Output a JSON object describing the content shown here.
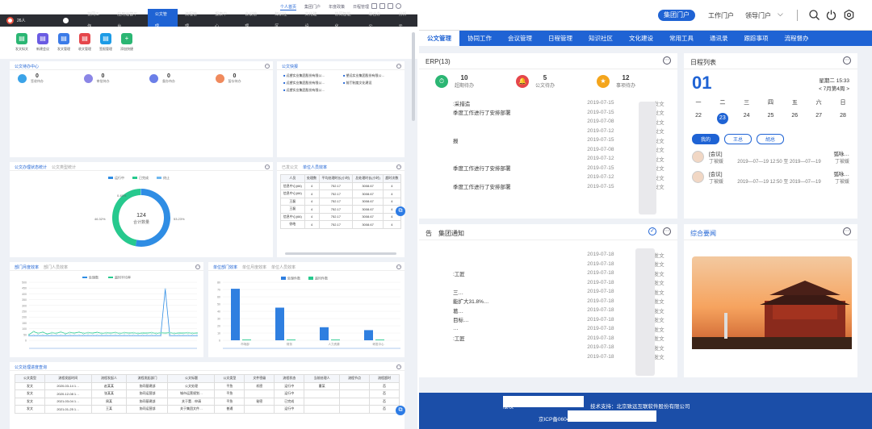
{
  "left": {
    "toplinks": [
      {
        "label": "个人首页",
        "active": true
      },
      {
        "label": "集团门户",
        "active": false
      },
      {
        "label": "年度政策",
        "active": false
      },
      {
        "label": "日程管理",
        "active": false
      }
    ],
    "user": "26人",
    "nav": [
      {
        "label": "协同工作"
      },
      {
        "label": "应用运营平台"
      },
      {
        "label": "公文管理",
        "active": true
      },
      {
        "label": "流程管理"
      },
      {
        "label": "报表中心"
      },
      {
        "label": "会议管理"
      },
      {
        "label": "知识社区"
      },
      {
        "label": "文化建设"
      },
      {
        "label": "协同智能化"
      },
      {
        "label": "综合办公"
      },
      {
        "label": "分析云"
      }
    ],
    "quick": [
      {
        "label": "发文拟文",
        "color": "#2bb673",
        "icon": "doc-icon"
      },
      {
        "label": "新建会议",
        "color": "#6a5be3",
        "icon": "meeting-icon"
      },
      {
        "label": "发文管理",
        "color": "#3b7be8",
        "icon": "send-icon"
      },
      {
        "label": "收文管理",
        "color": "#e5464b",
        "icon": "receive-icon"
      },
      {
        "label": "签报管理",
        "color": "#1c9be6",
        "icon": "report-icon"
      },
      {
        "label": "添加快捷",
        "color": "#2bb673",
        "icon": "plus-icon"
      }
    ],
    "todo": {
      "title": "公文待办中心",
      "items": [
        {
          "n": "0",
          "l": "签收待办",
          "color": "#3ba3e8"
        },
        {
          "label": "",
          "n": "0",
          "l": "审批待办",
          "color": "#8b86e6"
        },
        {
          "n": "0",
          "l": "督办待办",
          "color": "#6b7fe8"
        },
        {
          "n": "0",
          "l": "暂存待办",
          "color": "#f08a5d"
        }
      ]
    },
    "notice": {
      "title": "公文快报",
      "items": [
        "远望实业集团股份有限公…",
        "望远实业集团股份有限公…",
        "远望实业集团股份有限公…",
        "前厅制度文化建设",
        "远望实业集团股份有限公…"
      ]
    },
    "donut": {
      "title": "公文办理状态统计",
      "tab": "公文类型统计",
      "legend": [
        "运行中",
        "已完成",
        "终止"
      ],
      "center_value": "124",
      "center_label": "合计数量",
      "pct_left": "46.32%",
      "pct_right": "53.23%",
      "pct_top": "0.45%"
    },
    "unit": {
      "title": "已发公文",
      "tab": "单位人员效率",
      "cols": [
        "人员",
        "处理数",
        "平均处理时长(小时)",
        "总处理时长(小时)",
        "超时次数"
      ],
      "rows": [
        [
          "信息中心(66)",
          "4",
          "752.17",
          "3008.67",
          "4"
        ],
        [
          "信息中心(66)",
          "4",
          "752.17",
          "3008.67",
          "4"
        ],
        [
          "王磊",
          "4",
          "752.17",
          "3008.67",
          "4"
        ],
        [
          "王磊",
          "4",
          "752.17",
          "3008.67",
          "4"
        ],
        [
          "信息中心(66)",
          "4",
          "752.17",
          "3008.67",
          "4"
        ],
        [
          "徐皓",
          "4",
          "752.17",
          "3008.67",
          "4"
        ]
      ]
    },
    "line": {
      "title": "部门月度效率",
      "tab": "部门人员效率",
      "legend": [
        "处理数",
        "超时平均率"
      ]
    },
    "bar": {
      "title": "单位部门效率",
      "tab": "单位月度效率",
      "tab2": "单位人员效率",
      "legend": [
        "处理件数",
        "超时件数"
      ]
    },
    "query": {
      "title": "公文处理进度查询",
      "cols": [
        "公文类型",
        "流程发起时间",
        "流程发起人",
        "流程发起部门",
        "公文标题",
        "公文类型",
        "文件密级",
        "流程状态",
        "当前处理人",
        "流程节点",
        "流程超时"
      ],
      "rows": [
        [
          "发文",
          "2020-03-14 1…",
          "赵某某",
          "协同基建部",
          "公文处理",
          "平急",
          "机密",
          "运行中",
          "曹某",
          "",
          "否"
        ],
        [
          "发文",
          "2020-12-08 1…",
          "张某某",
          "协同运营部",
          "城市运营规划…",
          "平急",
          "",
          "运行中",
          "",
          "",
          "否"
        ],
        [
          "发文",
          "2021-03-04 1…",
          "周某",
          "协同基建部",
          "关于董…申请",
          "平急",
          "秘密",
          "已完成",
          "",
          "",
          "否"
        ],
        [
          "发文",
          "2021-01-25 1…",
          "王某",
          "协同运营部",
          "关于集团文件…",
          "普通",
          "",
          "运行中",
          "",
          "",
          "否"
        ]
      ]
    }
  },
  "chart_data": [
    {
      "type": "pie",
      "series": [
        {
          "name": "运行中",
          "value": 53.23
        },
        {
          "name": "已完成",
          "value": 46.32
        },
        {
          "name": "终止",
          "value": 0.45
        }
      ],
      "center_value": 124,
      "center_label": "合计数量"
    },
    {
      "type": "line",
      "series": [
        {
          "name": "处理数",
          "values": [
            40,
            40,
            40,
            40,
            40,
            40,
            40,
            40,
            40,
            40,
            40,
            40,
            40,
            40,
            40,
            40,
            40,
            40,
            40,
            40,
            40,
            40,
            40,
            40,
            40,
            40,
            40,
            40,
            40,
            40,
            440,
            40,
            40,
            40,
            40,
            40,
            40,
            40
          ]
        },
        {
          "name": "超时平均率",
          "values": [
            50,
            75,
            60,
            70,
            55,
            65,
            60,
            72,
            58,
            66,
            62,
            70,
            60,
            65,
            62,
            68,
            60,
            64,
            62,
            66,
            60,
            65,
            62,
            64,
            60,
            63,
            62,
            65,
            60,
            64,
            62,
            65,
            60,
            63,
            62,
            64,
            61,
            63
          ]
        }
      ],
      "ylim": [
        0,
        500
      ],
      "yticks": [
        0,
        50,
        100,
        150,
        200,
        250,
        300,
        350,
        400,
        450,
        500
      ]
    },
    {
      "type": "bar",
      "categories": [
        "市场部",
        "财务",
        "人力资源",
        "研发中心"
      ],
      "series": [
        {
          "name": "处理件数",
          "values": [
            71,
            45,
            18,
            14
          ]
        },
        {
          "name": "超时件数",
          "values": [
            1,
            1,
            1,
            1
          ]
        }
      ],
      "ylim": [
        0,
        80
      ],
      "yticks": [
        0,
        10,
        20,
        30,
        40,
        50,
        60,
        70,
        80
      ]
    }
  ],
  "right": {
    "header": {
      "portal": "集团门户",
      "work": "工作门户",
      "leader": "领导门户"
    },
    "nav": [
      {
        "label": "公文管理",
        "active": true
      },
      {
        "label": "协同工作"
      },
      {
        "label": "会议管理"
      },
      {
        "label": "日程管理"
      },
      {
        "label": "知识社区"
      },
      {
        "label": "文化建设"
      },
      {
        "label": "常用工具"
      },
      {
        "label": "通讯录"
      },
      {
        "label": "跟踪事项"
      },
      {
        "label": "流程督办"
      }
    ],
    "erp": {
      "title": "ERP(13)",
      "stats": [
        {
          "n": "10",
          "l": "超期待办",
          "color": "#2bb673"
        },
        {
          "n": "5",
          "l": "公文待办",
          "color": "#e5464b"
        },
        {
          "n": "12",
          "l": "事项待办",
          "color": "#f4a51c"
        }
      ],
      "rows": [
        {
          "t": ":采措造",
          "d": "2019-07-15",
          "ty": "发文"
        },
        {
          "t": "季度工作进行了安排部署",
          "d": "2019-07-15",
          "ty": "发文"
        },
        {
          "t": "",
          "d": "2019-07-08",
          "ty": "发文"
        },
        {
          "t": "",
          "d": "2019-07-12",
          "ty": "发文"
        },
        {
          "t": "报",
          "d": "2019-07-15",
          "ty": "发文"
        },
        {
          "t": "",
          "d": "2019-07-08",
          "ty": "发文"
        },
        {
          "t": "",
          "d": "2019-07-12",
          "ty": "发文"
        },
        {
          "t": "季度工作进行了安排部署",
          "d": "2019-07-15",
          "ty": "发文"
        },
        {
          "t": "",
          "d": "2019-07-12",
          "ty": "发文"
        },
        {
          "t": "季度工作进行了安排部署",
          "d": "2019-07-15",
          "ty": "发文"
        }
      ]
    },
    "notice": {
      "title": "告",
      "tab": "集团通知",
      "rows": [
        {
          "t": "",
          "d": "2019-07-18",
          "ty": "发文"
        },
        {
          "t": "",
          "d": "2019-07-18",
          "ty": "发文"
        },
        {
          "t": ":工匠",
          "d": "2019-07-18",
          "ty": "发文"
        },
        {
          "t": "",
          "d": "2019-07-18",
          "ty": "发文"
        },
        {
          "t": "三…",
          "d": "2019-07-18",
          "ty": "发文"
        },
        {
          "t": "能扩大31.8%…",
          "d": "2019-07-18",
          "ty": "发文"
        },
        {
          "t": "葛…",
          "d": "2019-07-18",
          "ty": "发文"
        },
        {
          "t": "目标…",
          "d": "2019-07-18",
          "ty": "发文"
        },
        {
          "t": "…",
          "d": "2019-07-18",
          "ty": "发文"
        },
        {
          "t": ":工匠",
          "d": "2019-07-18",
          "ty": "发文"
        },
        {
          "t": "",
          "d": "2019-07-18",
          "ty": "发文"
        },
        {
          "t": "",
          "d": "2019-07-18",
          "ty": "发文"
        }
      ]
    },
    "cal": {
      "title": "日程列表",
      "day": "01",
      "date_line1": "星期二 15:33",
      "date_line2": "< 7月第4周 >",
      "weekdays": [
        "一",
        "二",
        "三",
        "四",
        "五",
        "六",
        "日"
      ],
      "days": [
        "22",
        "23",
        "24",
        "25",
        "26",
        "27",
        "28"
      ],
      "tabs": [
        "我的",
        "王总",
        "胡总"
      ],
      "meetings": [
        {
          "t": "[会议]",
          "s": "弧咏…",
          "n": "丁被媛",
          "d": "2019—07—19  12:50  至  2019—07—19",
          "d2": "丁被媛"
        },
        {
          "t": "[会议]",
          "s": "弧咏…",
          "n": "丁被媛",
          "d": "2019—07—19  12:50  至  2019—07—19",
          "d2": "丁被媛"
        }
      ]
    },
    "news": {
      "title": "综合要闻"
    },
    "footer": {
      "a": "版权",
      "b": "技术支持：北京致远互联软件股份有限公司",
      "c": "京ICP备06041"
    }
  }
}
